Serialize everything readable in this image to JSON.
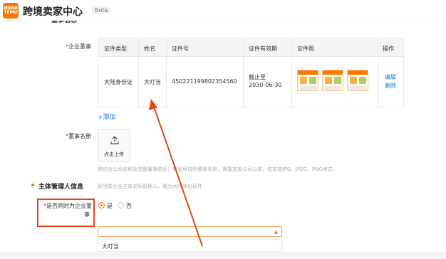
{
  "app": {
    "logo_line1": "跨境卖家",
    "logo_line2": "TEMU",
    "title": "跨境卖家中心",
    "badge": "Beta"
  },
  "section_peek": "董事信息",
  "directors": {
    "label": "企业董事",
    "columns": [
      "证件类型",
      "姓名",
      "证件号",
      "证件有效期",
      "证件照",
      "操作"
    ],
    "row": {
      "id_type": "大陆身份证",
      "name": "大叮当",
      "id_number": "450221199802354560",
      "validity_line1": "截止至",
      "validity_line2": "2030-06-30",
      "edit": "编辑",
      "delete": "删除"
    },
    "add_link": "+添加"
  },
  "register": {
    "label": "董事名册",
    "upload_text": "点击上传",
    "hint": "需包含公司名称及完整董事信息；若采用自制董事名册，需要加盖公司公章；仅支持JPG、JPEG、PNG格式"
  },
  "manager": {
    "title": "主体管理人信息",
    "subtitle": "即当前企业主体实际管理人，需为大陆身份证件",
    "question_line1": "是否同时为企业董",
    "question_line2": "事",
    "yes": "是",
    "no": "否",
    "select_value": "",
    "dropdown_option": "大叮当"
  },
  "colors": {
    "brand": "#fb7701",
    "link": "#1f6fd1",
    "highlight": "#e0461e",
    "arrow": "#e0461e"
  }
}
